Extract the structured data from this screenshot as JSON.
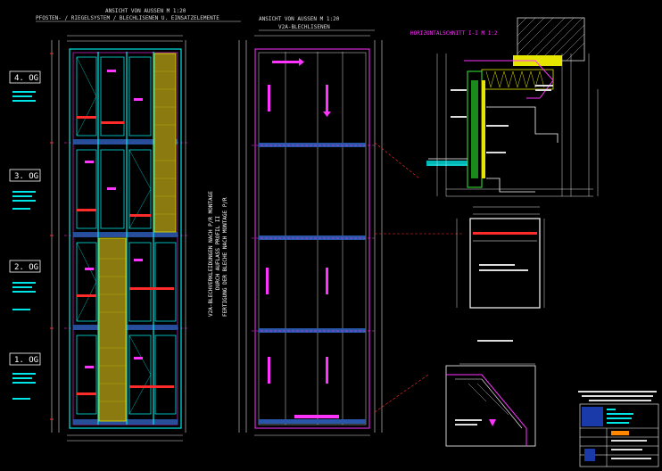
{
  "view1": {
    "title_line1": "ANSICHT VON AUSSEN M 1:20",
    "title_line2": "PFOSTEN- / RIEGELSYSTEM / BLECHLISENEN U. EINSATZELEMENTE"
  },
  "view2": {
    "title_line1": "ANSICHT VON AUSSEN M 1:20",
    "title_line2": "V2A-BLECHLISENEN"
  },
  "section": {
    "title": "HORIZONTALSCHNITT I-I   M 1:2"
  },
  "floors": [
    "4. OG",
    "3. OG",
    "2. OG",
    "1. OG"
  ],
  "vertical_note": {
    "line1": "V2A-BLECHVERKLEIDUNGEN NACH P/R MONTAGE",
    "line2": "DURCH AUFLASS PROFIL II",
    "line3": "FERTIGUNG DER BLECHE NACH MONTAGE P/R"
  },
  "colors": {
    "cyan": "#00e5e5",
    "magenta": "#ff33ff",
    "yellow": "#e5e500",
    "red": "#ff2a2a",
    "green": "#33ee33",
    "white": "#ffffff",
    "orange": "#ff8800"
  }
}
